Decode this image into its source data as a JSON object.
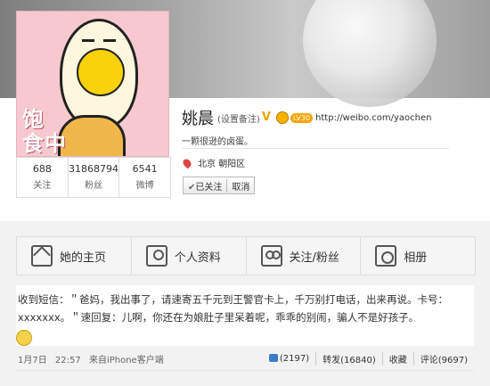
{
  "profile": {
    "name": "姚晨",
    "remark_label": "(设置备注)",
    "verified_badge": "V",
    "level_badge": "LV30",
    "url": "http://weibo.com/yaochen",
    "bio": "一颗很逊的卤蛋。",
    "location_province": "北京",
    "location_district": "朝阳区",
    "avatar_text": "饱\n食中",
    "followed_label": "已关注",
    "cancel_label": "取消"
  },
  "stats": [
    {
      "value": "688",
      "label": "关注"
    },
    {
      "value": "31868794",
      "label": "粉丝"
    },
    {
      "value": "6541",
      "label": "微博"
    }
  ],
  "tabs": [
    {
      "label": "她的主页",
      "icon": "home-icon"
    },
    {
      "label": "个人资料",
      "icon": "person-icon"
    },
    {
      "label": "关注/粉丝",
      "icon": "people-icon"
    },
    {
      "label": "相册",
      "icon": "camera-icon"
    }
  ],
  "post": {
    "text": "收到短信：＂爸妈，我出事了，请速寄五千元到王警官卡上，千万别打电话，出来再说。卡号：xxxxxxx。＂速回复：儿啊，你还在为娘肚子里呆着呢，乖乖的别闹，骗人不是好孩子。",
    "date": "1月7日",
    "time": "22:57",
    "source": "来自iPhone客户端",
    "likes": "(2197)",
    "repost": "转发(16840)",
    "favorite": "收藏",
    "comment": "评论(9697)"
  },
  "colors": {
    "accent": "#f6a300",
    "avatar_bg": "#f7c9cf",
    "like_icon": "#3a7dc9"
  }
}
